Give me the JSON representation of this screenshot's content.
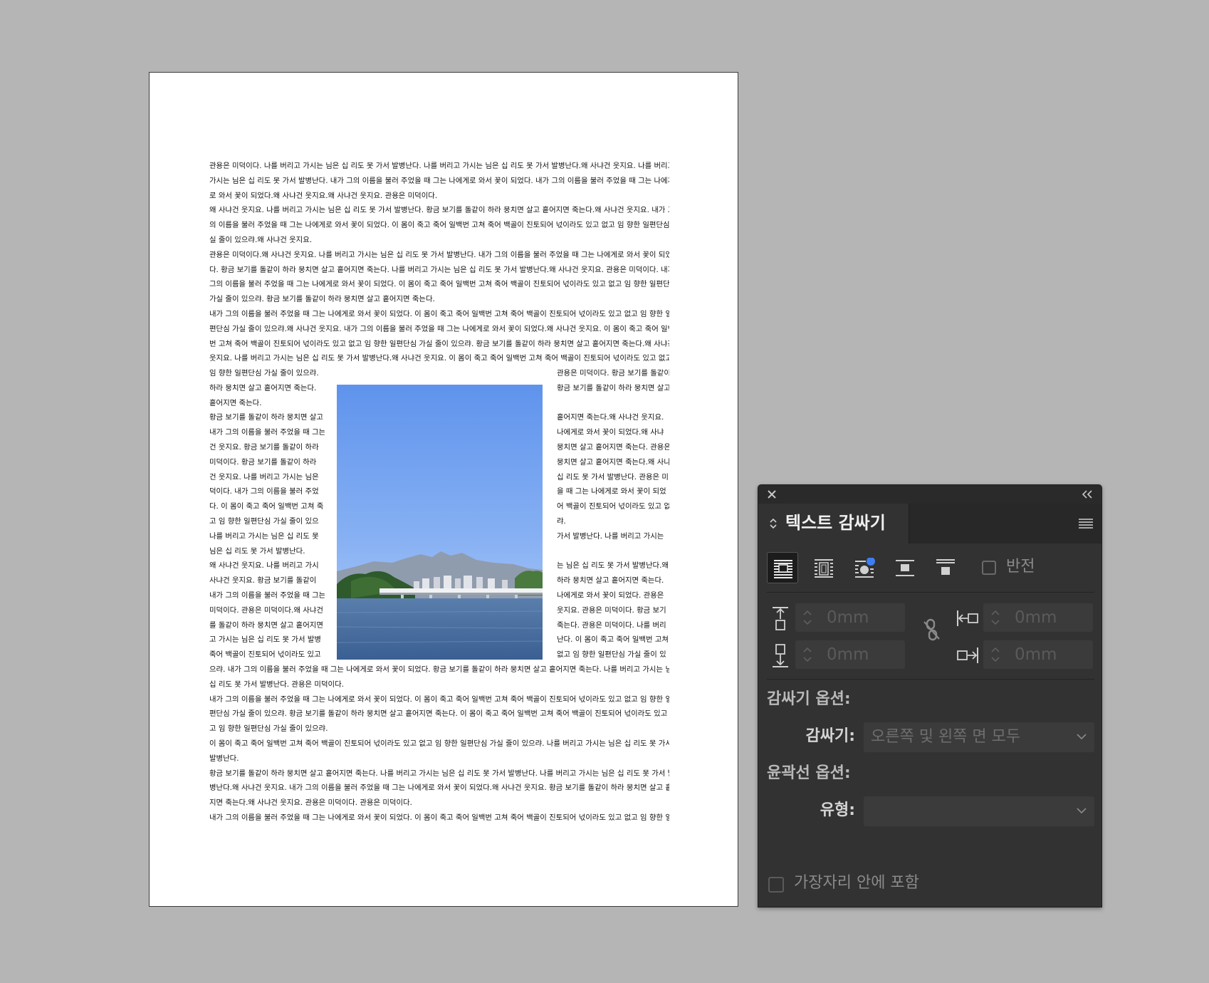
{
  "document": {
    "lines_top": [
      " 관용은 미덕이다. 나를 버리고 가시는 님은 십 리도 못 가서 발병난다. 나를 버리고 가시는 님은 십 리도 못 가서 발병난다.왜 사냐건 웃지요. 나를 버리고",
      "가시는 님은 십 리도 못 가서 발병난다. 내가 그의 이름을 불러 주었을 때 그는 나에게로 와서 꽃이 되었다. 내가 그의 이름을 불러 주었을 때 그는 나에게",
      "로 와서 꽃이 되었다.왜 사냐건 웃지요.왜 사냐건 웃지요. 관용은 미덕이다.",
      "왜 사냐건 웃지요. 나를 버리고 가시는 님은 십 리도 못 가서 발병난다. 황금 보기를 돌같이 하라 뭉치면 살고 흩어지면 죽는다.왜 사냐건 웃지요. 내가 그",
      "의 이름을 불러 주었을 때 그는 나에게로 와서 꽃이 되었다. 이 몸이 죽고 죽어 일백번 고쳐 죽어 백골이 진토되어 넋이라도 있고 없고 임 향한 일편단심 가",
      "실 줄이 있으랴.왜 사냐건 웃지요.",
      " 관용은 미덕이다.왜 사냐건 웃지요. 나를 버리고 가시는 님은 십 리도 못 가서 발병난다. 내가 그의 이름을 불러 주었을 때 그는 나에게로 와서 꽃이 되었",
      "다. 황금 보기를 돌같이 하라 뭉치면 살고 흩어지면 죽는다. 나를 버리고 가시는 님은 십 리도 못 가서 발병난다.왜 사냐건 웃지요. 관용은 미덕이다. 내가",
      "그의 이름을 불러 주었을 때 그는 나에게로 와서 꽃이 되었다. 이 몸이 죽고 죽어 일백번 고쳐 죽어 백골이 진토되어 넋이라도 있고 없고 임 향한 일편단심",
      "가실 줄이 있으랴. 황금 보기를 돌같이 하라 뭉치면 살고 흩어지면 죽는다.",
      " 내가 그의 이름을 불러 주었을 때 그는 나에게로 와서 꽃이 되었다. 이 몸이 죽고 죽어 일백번 고쳐 죽어 백골이 진토되어 넋이라도 있고 없고 임 향한 일",
      "편단심 가실 줄이 있으랴.왜 사냐건 웃지요. 내가 그의 이름을 불러 주었을 때 그는 나에게로 와서 꽃이 되었다.왜 사냐건 웃지요. 이 몸이 죽고 죽어 일백",
      "번 고쳐 죽어 백골이 진토되어 넋이라도 있고 없고 임 향한 일편단심 가실 줄이 있으랴. 황금 보기를 돌같이 하라 뭉치면 살고 흩어지면 죽는다.왜 사냐건",
      "웃지요. 나를 버리고 가시는 님은 십 리도 못 가서 발병난다.왜 사냐건 웃지요. 이 몸이 죽고 죽어 일백번 고쳐 죽어 백골이 진토되어 넋이라도 있고 없고"
    ],
    "lines_left": [
      "임 향한 일편단심 가실 줄이 있으랴.",
      "하라 뭉치면 살고 흩어지면 죽는다.",
      "흩어지면 죽는다.",
      " 황금 보기를 돌같이 하라 뭉치면 살고",
      "내가 그의 이름을 불러 주었을 때 그는",
      "건 웃지요. 황금 보기를 돌같이 하라",
      "미덕이다. 황금 보기를 돌같이 하라",
      "건 웃지요. 나를 버리고 가시는 님은",
      "덕이다. 내가 그의 이름을 불러 주었",
      "다. 이 몸이 죽고 죽어 일백번 고쳐 죽",
      "고 임 향한 일편단심 가실 줄이 있으",
      " 나를 버리고 가시는 님은 십 리도 못",
      "님은 십 리도 못 가서 발병난다.",
      "왜 사냐건 웃지요. 나를 버리고 가시",
      "사냐건 웃지요. 황금 보기를 돌같이",
      "내가 그의 이름을 불러 주었을 때 그는",
      "미덕이다. 관용은 미덕이다.왜 사냐건",
      "를 돌같이 하라 뭉치면 살고 흩어지면",
      "고 가시는 님은 십 리도 못 가서 발병",
      "죽어 백골이 진토되어 넋이라도 있고"
    ],
    "lines_right": [
      "관용은 미덕이다. 황금 보기를 돌같이",
      "황금 보기를 돌같이 하라 뭉치면 살고",
      "",
      "흩어지면 죽는다.왜 사냐건 웃지요.",
      "나에게로 와서 꽃이 되었다.왜 사냐",
      "뭉치면 살고 흩어지면 죽는다. 관용은",
      "뭉치면 살고 흩어지면 죽는다.왜 사냐",
      "십 리도 못 가서 발병난다. 관용은 미",
      "을 때 그는 나에게로 와서 꽃이 되었",
      "어 백골이 진토되어 넋이라도 있고 없",
      "랴.",
      "가서 발병난다. 나를 버리고 가시는",
      "",
      "는 님은 십 리도 못 가서 발병난다.왜",
      "하라 뭉치면 살고 흩어지면 죽는다.",
      "나에게로 와서 꽃이 되었다. 관용은",
      "웃지요. 관용은 미덕이다. 황금 보기",
      "죽는다. 관용은 미덕이다. 나를 버리",
      "난다. 이 몸이 죽고 죽어 일백번 고쳐",
      "없고 임 향한 일편단심 가실 줄이 있"
    ],
    "lines_bottom": [
      "으랴. 내가 그의 이름을 불러 주었을 때 그는 나에게로 와서 꽃이 되었다. 황금 보기를 돌같이 하라 뭉치면 살고 흩어지면 죽는다. 나를 버리고 가시는 님은",
      "십 리도 못 가서 발병난다. 관용은 미덕이다.",
      " 내가 그의 이름을 불러 주었을 때 그는 나에게로 와서 꽃이 되었다. 이 몸이 죽고 죽어 일백번 고쳐 죽어 백골이 진토되어 넋이라도 있고 없고 임 향한 일",
      "편단심 가실 줄이 있으랴. 황금 보기를 돌같이 하라 뭉치면 살고 흩어지면 죽는다. 이 몸이 죽고 죽어 일백번 고쳐 죽어 백골이 진토되어 넋이라도 있고 없",
      "고 임 향한 일편단심 가실 줄이 있으랴.",
      " 이 몸이 죽고 죽어 일백번 고쳐 죽어 백골이 진토되어 넋이라도 있고 없고 임 향한 일편단심 가실 줄이 있으랴. 나를 버리고 가시는 님은 십 리도 못 가서",
      "발병난다.",
      " 황금 보기를 돌같이 하라 뭉치면 살고 흩어지면 죽는다. 나를 버리고 가시는 님은 십 리도 못 가서 발병난다. 나를 버리고 가시는 님은 십 리도 못 가서 발",
      "병난다.왜 사냐건 웃지요. 내가 그의 이름을 불러 주었을 때 그는 나에게로 와서 꽃이 되었다.왜 사냐건 웃지요. 황금 보기를 돌같이 하라 뭉치면 살고 흩어",
      "지면 죽는다.왜 사냐건 웃지요. 관용은 미덕이다. 관용은 미덕이다.",
      " 내가 그의 이름을 불러 주었을 때 그는 나에게로 와서 꽃이 되었다. 이 몸이 죽고 죽어 일백번 고쳐 죽어 백골이 진토되어 넋이라도 있고 없고 임 향한 일"
    ]
  },
  "panel": {
    "tab_title": "텍스트 감싸기",
    "wrap_buttons": [
      {
        "name": "no-wrap",
        "icon": "no-wrap-icon",
        "active": true
      },
      {
        "name": "bounding-box-wrap",
        "icon": "bounding-box-wrap-icon",
        "active": false
      },
      {
        "name": "object-shape-wrap",
        "icon": "object-shape-wrap-icon",
        "active": false
      },
      {
        "name": "jump-object-wrap",
        "icon": "jump-object-wrap-icon",
        "active": false
      },
      {
        "name": "jump-next-column-wrap",
        "icon": "jump-next-column-wrap-icon",
        "active": false
      }
    ],
    "invert_label": "반전",
    "offsets": {
      "top": "0mm",
      "bottom": "0mm",
      "left": "0mm",
      "right": "0mm"
    },
    "wrap_options_heading": "감싸기 옵션:",
    "wrap_to_label": "감싸기:",
    "wrap_to_value": "오른쪽 및 왼쪽 면 모두",
    "contour_options_heading": "윤곽선 옵션:",
    "type_label": "유형:",
    "type_value": "",
    "include_inside_edges_label": "가장자리 안에 포함"
  },
  "colors": {
    "canvas": "#b5b5b5",
    "panel_bg": "#323232",
    "accent_blue": "#3f7ef0"
  }
}
